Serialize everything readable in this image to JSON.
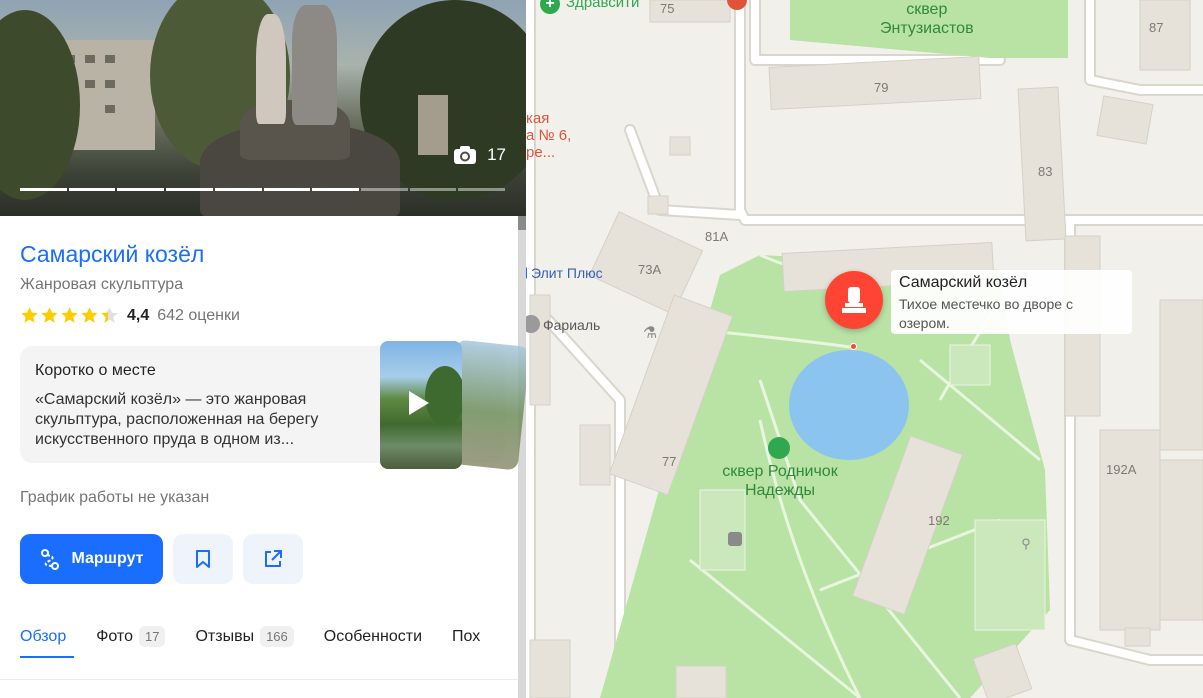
{
  "place": {
    "title": "Самарский козёл",
    "category": "Жанровая скульптура",
    "rating_value": "4,4",
    "rating_stars": 4.4,
    "rating_count": "642 оценки",
    "photo_count": "17",
    "photo_progress_segments": 10,
    "photo_progress_active": 7
  },
  "about": {
    "title": "Коротко о месте",
    "text": "«Самарский козёл» — это жанровая скульптура, расположенная на берегу искусственного пруда в одном из..."
  },
  "hours": "График работы не указан",
  "actions": {
    "route_label": "Маршрут",
    "save_icon": "bookmark-icon",
    "share_icon": "share-icon"
  },
  "tabs": [
    {
      "label": "Обзор",
      "count": ""
    },
    {
      "label": "Фото",
      "count": "17"
    },
    {
      "label": "Отзывы",
      "count": "166"
    },
    {
      "label": "Особенности",
      "count": ""
    },
    {
      "label": "Пох",
      "count": ""
    }
  ],
  "map": {
    "marker": {
      "name": "Самарский козёл",
      "description": "Тихое местечко во дворе с озером."
    },
    "labels": {
      "park_top_1": "сквер",
      "park_top_2": "Энтузиастов",
      "park_main_1": "сквер Родничок",
      "park_main_2": "Надежды",
      "poi_zdravsiti": "Здравсити",
      "poi_elit": "Элит Плюс",
      "poi_farial": "Фариаль",
      "poi_red_1": "кая",
      "poi_red_2": "а № 6,",
      "poi_red_3": "ре..."
    },
    "house_numbers": {
      "h75": "75",
      "h87": "87",
      "h79": "79",
      "h83": "83",
      "h81a": "81А",
      "h73a": "73А",
      "h77": "77",
      "h192": "192",
      "h192a": "192А"
    },
    "colors": {
      "background": "#f2f0ea",
      "park": "#b9e2a5",
      "water": "#8cc4f0",
      "building": "#e6e2da",
      "road": "#ffffff",
      "marker": "#ff4433",
      "accent": "#196dff"
    }
  }
}
